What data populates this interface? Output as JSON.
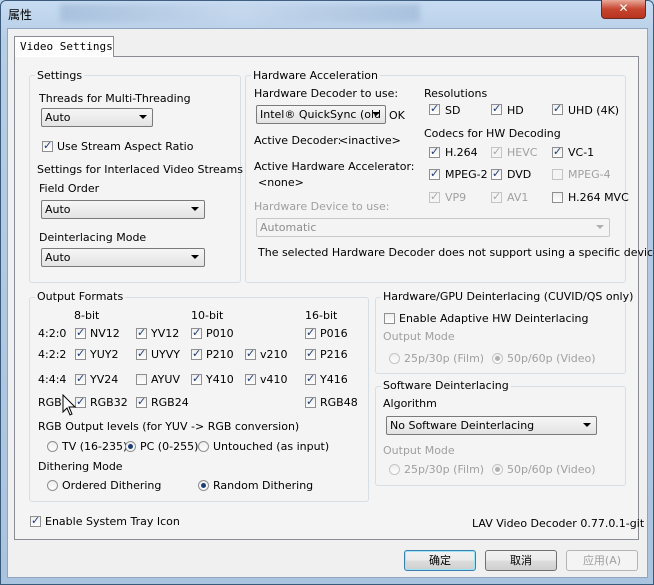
{
  "window": {
    "title": "属性",
    "close": "✕"
  },
  "tab": "Video Settings",
  "settings": {
    "title": "Settings",
    "threads_label": "Threads for Multi-Threading",
    "threads_value": "Auto",
    "stream_ar": "Use Stream Aspect Ratio",
    "interlaced_label": "Settings for Interlaced Video Streams",
    "field_order_label": "Field Order",
    "field_order_value": "Auto",
    "deint_mode_label": "Deinterlacing Mode",
    "deint_mode_value": "Auto"
  },
  "hwaccel": {
    "title": "Hardware Acceleration",
    "decoder_label": "Hardware Decoder to use:",
    "decoder_value": "Intel® QuickSync (old",
    "decoder_status": "OK",
    "active_decoder_label": "Active Decoder:",
    "active_decoder_value": "<inactive>",
    "active_accel_label": "Active Hardware Accelerator:",
    "active_accel_value": "<none>",
    "device_label": "Hardware Device to use:",
    "device_value": "Automatic",
    "device_note": "The selected Hardware Decoder does not support using a specific device.",
    "resolutions_label": "Resolutions",
    "resolutions": [
      "SD",
      "HD",
      "UHD (4K)"
    ],
    "codecs_label": "Codecs for HW Decoding",
    "codecs": [
      "H.264",
      "HEVC",
      "VC-1",
      "MPEG-2",
      "DVD",
      "MPEG-4",
      "VP9",
      "AV1",
      "H.264 MVC"
    ]
  },
  "output": {
    "title": "Output Formats",
    "col_headers": [
      "8-bit",
      "10-bit",
      "16-bit"
    ],
    "row_labels": [
      "4:2:0",
      "4:2:2",
      "4:4:4",
      "RGB"
    ],
    "formats": [
      "NV12",
      "YV12",
      "P010",
      "P016",
      "YUY2",
      "UYVY",
      "P210",
      "v210",
      "P216",
      "YV24",
      "AYUV",
      "Y410",
      "v410",
      "Y416",
      "RGB32",
      "RGB24",
      "RGB48"
    ],
    "rgb_levels_label": "RGB Output levels (for YUV -> RGB conversion)",
    "rgb_levels": [
      "TV (16-235)",
      "PC (0-255)",
      "Untouched (as input)"
    ],
    "dither_label": "Dithering Mode",
    "dither": [
      "Ordered Dithering",
      "Random Dithering"
    ]
  },
  "hwdeint": {
    "title": "Hardware/GPU Deinterlacing (CUVID/QS only)",
    "enable": "Enable Adaptive HW Deinterlacing",
    "output_mode_label": "Output Mode",
    "modes": [
      "25p/30p (Film)",
      "50p/60p (Video)"
    ]
  },
  "swdeint": {
    "title": "Software Deinterlacing",
    "algorithm_label": "Algorithm",
    "algorithm_value": "No Software Deinterlacing",
    "output_mode_label": "Output Mode",
    "modes": [
      "25p/30p (Film)",
      "50p/60p (Video)"
    ]
  },
  "footer": {
    "tray": "Enable System Tray Icon",
    "version": "LAV Video Decoder 0.77.0.1-git",
    "ok": "确定",
    "cancel": "取消",
    "apply": "应用(A)"
  }
}
